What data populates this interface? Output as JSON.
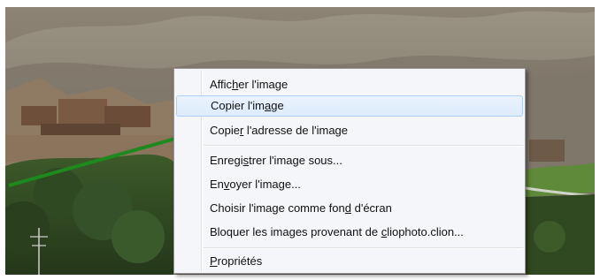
{
  "context_menu": {
    "items": [
      {
        "pre": "Affic",
        "key": "h",
        "post": "er l'image"
      },
      {
        "pre": "Copier l'im",
        "key": "a",
        "post": "ge"
      },
      {
        "pre": "Copie",
        "key": "r",
        "post": " l'adresse de l'image"
      },
      {
        "pre": "Enregi",
        "key": "s",
        "post": "trer l'image sous..."
      },
      {
        "pre": "En",
        "key": "v",
        "post": "oyer l'image..."
      },
      {
        "pre": "Choisir l'image comme fon",
        "key": "d",
        "post": " d'écran"
      },
      {
        "pre": "Bloquer les images provenant de ",
        "key": "c",
        "post": "liophoto.clion..."
      },
      {
        "pre": "",
        "key": "P",
        "post": "ropriétés"
      }
    ],
    "highlighted_index": 1
  },
  "colors": {
    "arrow": "#1e8a1e",
    "menu_bg": "#f4f6f9",
    "highlight_border": "#aecff7"
  }
}
